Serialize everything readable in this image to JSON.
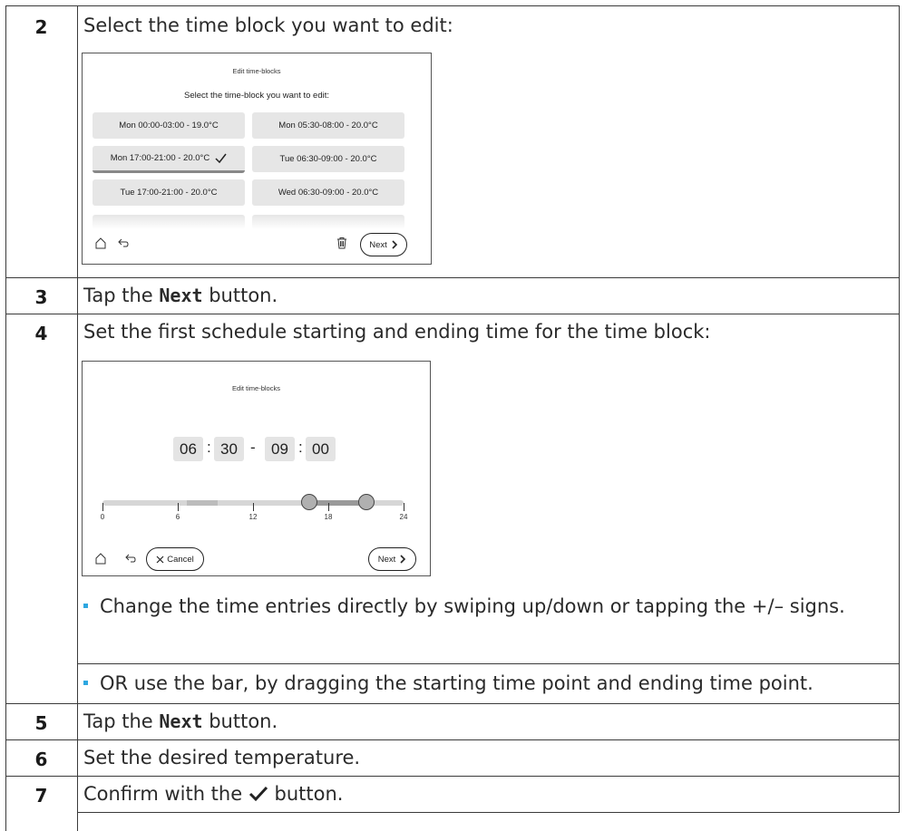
{
  "steps": [
    {
      "num": "2",
      "text": "Select the time block you want to edit:"
    },
    {
      "num": "3",
      "text_before": "Tap the ",
      "code": "Next",
      "text_after": " button."
    },
    {
      "num": "4",
      "text": "Set the first schedule starting and ending time for the time block:"
    },
    {
      "num": "5",
      "text_before": "Tap the ",
      "code": "Next",
      "text_after": " button."
    },
    {
      "num": "6",
      "text": "Set the desired temperature."
    },
    {
      "num": "7",
      "text_before": "Confirm with the ",
      "text_after": " button."
    }
  ],
  "screen1": {
    "title": "Edit time-blocks",
    "subtitle": "Select the time-block you want to edit:",
    "tiles": [
      "Mon 00:00-03:00 - 19.0°C",
      "Mon 05:30-08:00 - 20.0°C",
      "Mon 17:00-21:00 - 20.0°C",
      "Tue 06:30-09:00 - 20.0°C",
      "Tue 17:00-21:00 - 20.0°C",
      "Wed 06:30-09:00 - 20.0°C"
    ],
    "next_label": "Next"
  },
  "screen2": {
    "title": "Edit time-blocks",
    "start_hour": "06",
    "start_min": "30",
    "end_hour": "09",
    "end_min": "00",
    "colon": ":",
    "dash": "-",
    "axis_labels": [
      "0",
      "6",
      "12",
      "18",
      "24"
    ],
    "slider_start_hour": 16.5,
    "slider_end_hour": 21.0,
    "cancel_label": "Cancel",
    "next_label": "Next"
  },
  "bullets": [
    "Change the time entries directly by swiping up/down or tapping the +/– signs.",
    "OR use the bar, by dragging the starting time point and ending time point."
  ],
  "colors": {
    "bullet": "#2ea7e0",
    "tile": "#e6e6e6",
    "slider_track": "#d6d6d6",
    "slider_active": "#9a9a9a"
  }
}
